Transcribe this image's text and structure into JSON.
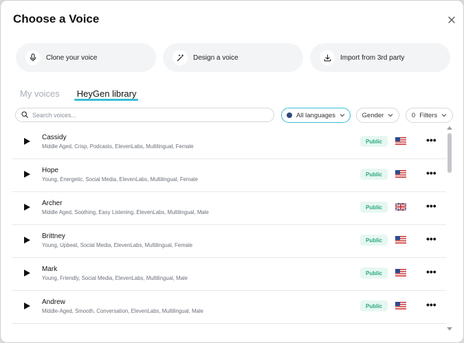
{
  "dialog": {
    "title": "Choose a Voice",
    "close_icon": "close-icon"
  },
  "actions": [
    {
      "label": "Clone your voice",
      "icon": "microphone-icon"
    },
    {
      "label": "Design a voice",
      "icon": "magic-wand-icon"
    },
    {
      "label": "Import from 3rd party",
      "icon": "download-icon"
    }
  ],
  "tabs": [
    {
      "label": "My voices",
      "active": false
    },
    {
      "label": "HeyGen library",
      "active": true
    }
  ],
  "search": {
    "placeholder": "Search voices...",
    "value": ""
  },
  "filters": {
    "language": "All languages",
    "gender": "Gender",
    "filters_count": "0",
    "filters_label": "Filters"
  },
  "voices": [
    {
      "name": "Cassidy",
      "tags": "Middle Aged, Crisp, Podcasts, ElevenLabs, Multilingual, Female",
      "badge": "Public",
      "flag": "us"
    },
    {
      "name": "Hope",
      "tags": "Young, Energetic, Social Media, ElevenLabs, Multilingual, Female",
      "badge": "Public",
      "flag": "us"
    },
    {
      "name": "Archer",
      "tags": "Middle Aged, Soothing, Easy Listening, ElevenLabs, Multilingual, Male",
      "badge": "Public",
      "flag": "uk"
    },
    {
      "name": "Brittney",
      "tags": "Young, Upbeat, Social Media, ElevenLabs, Multilingual, Female",
      "badge": "Public",
      "flag": "us"
    },
    {
      "name": "Mark",
      "tags": "Young, Friendly, Social Media, ElevenLabs, Multilingual, Male",
      "badge": "Public",
      "flag": "us"
    },
    {
      "name": "Andrew",
      "tags": "Middle-Aged, Smooth, Conversation, ElevenLabs, Multilingual, Male",
      "badge": "Public",
      "flag": "us"
    }
  ],
  "colors": {
    "accent": "#38bdd6",
    "badge_bg": "#e6f7f1",
    "badge_text": "#2aa882"
  }
}
